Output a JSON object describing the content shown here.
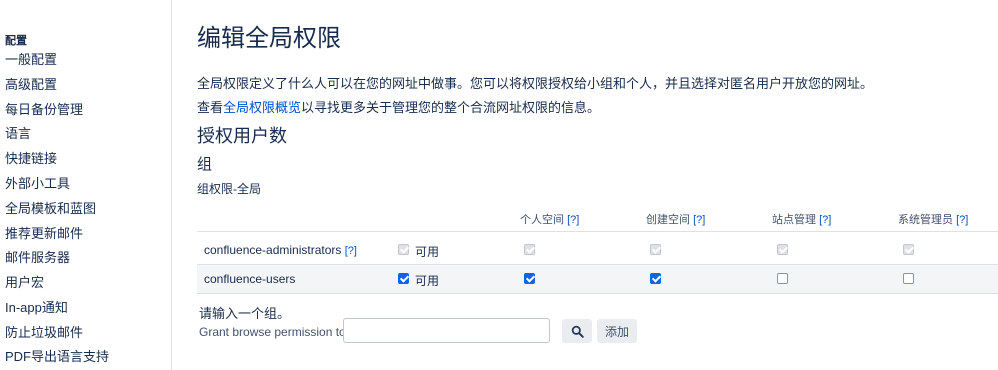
{
  "sidebar": {
    "heading": "配置",
    "items": [
      {
        "label": "一般配置"
      },
      {
        "label": "高级配置"
      },
      {
        "label": "每日备份管理"
      },
      {
        "label": "语言"
      },
      {
        "label": "快捷链接"
      },
      {
        "label": "外部小工具"
      },
      {
        "label": "全局模板和蓝图"
      },
      {
        "label": "推荐更新邮件"
      },
      {
        "label": "邮件服务器"
      },
      {
        "label": "用户宏"
      },
      {
        "label": "In-app通知"
      },
      {
        "label": "防止垃圾邮件"
      },
      {
        "label": "PDF导出语言支持"
      }
    ]
  },
  "main": {
    "title": "编辑全局权限",
    "description": "全局权限定义了什么人可以在您的网址中做事。您可以将权限授权给小组和个人，并且选择对匿名用户开放您的网址。",
    "overview_prefix": "查看",
    "overview_link": "全局权限概览",
    "overview_suffix": "以寻找更多关于管理您的整个合流网址权限的信息。",
    "section_title": "授权用户数",
    "group_title": "组",
    "group_subtitle": "组权限-全局"
  },
  "table": {
    "help": "[?]",
    "columns": [
      "个人空间",
      "创建空间",
      "站点管理",
      "系统管理员"
    ],
    "available_label": "可用",
    "rows": [
      {
        "group": "confluence-administrators",
        "has_help": true,
        "available": true,
        "disabled": true,
        "perms": [
          true,
          true,
          true,
          true
        ]
      },
      {
        "group": "confluence-users",
        "has_help": false,
        "available": true,
        "disabled": false,
        "perms": [
          true,
          true,
          false,
          false
        ]
      }
    ]
  },
  "grant": {
    "enter_group": "请输入一个组。",
    "label": "Grant browse permission to",
    "input_value": "",
    "search_icon": "search-icon",
    "add_label": "添加"
  }
}
